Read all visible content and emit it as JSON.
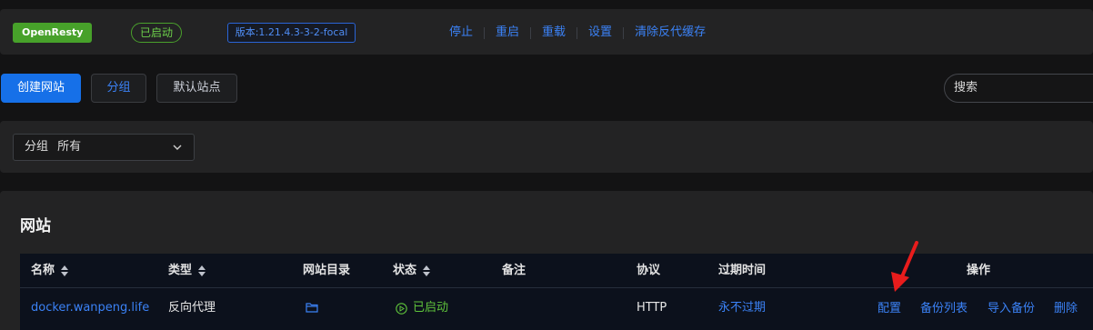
{
  "topbar": {
    "server_name": "OpenResty",
    "status": "已启动",
    "version": "版本:1.21.4.3-3-2-focal",
    "actions": [
      "停止",
      "重启",
      "重载",
      "设置",
      "清除反代缓存"
    ]
  },
  "toolbar": {
    "create_label": "创建网站",
    "group_label": "分组",
    "default_site_label": "默认站点",
    "search_placeholder": "搜索"
  },
  "filter": {
    "label": "分组",
    "value": "所有"
  },
  "sites": {
    "title": "网站",
    "columns": [
      "名称",
      "类型",
      "网站目录",
      "状态",
      "备注",
      "协议",
      "过期时间",
      "操作"
    ],
    "rows": [
      {
        "name": "docker.wanpeng.life",
        "type": "反向代理",
        "status": "已启动",
        "note": "",
        "protocol": "HTTP",
        "expiry": "永不过期",
        "ops": [
          "配置",
          "备份列表",
          "导入备份",
          "删除"
        ]
      }
    ]
  },
  "colors": {
    "accent": "#3b82f6",
    "primary_button": "#1670e8",
    "success": "#5fc43b",
    "annotation_arrow": "#e81c1c"
  },
  "icons": {
    "folder": "folder-icon",
    "status": "play-circle-icon",
    "chevron": "chevron-down-icon",
    "sort": "sort-icon"
  }
}
